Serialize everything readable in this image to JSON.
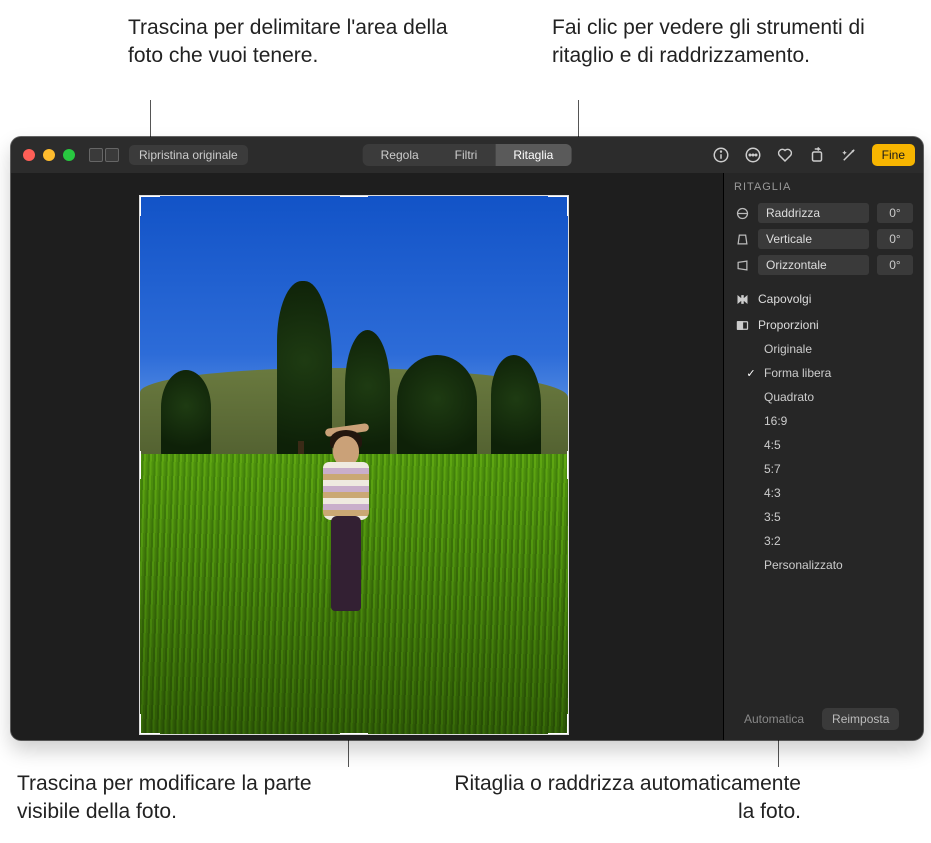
{
  "callouts": {
    "top_left": "Trascina per delimitare l'area della foto che vuoi tenere.",
    "top_right": "Fai clic per vedere gli strumenti di ritaglio e di raddrizzamento.",
    "bottom_left": "Trascina per modificare la parte visibile della foto.",
    "bottom_right": "Ritaglia o raddrizza automaticamente la foto."
  },
  "toolbar": {
    "restore_label": "Ripristina originale",
    "segments": {
      "adjust": "Regola",
      "filters": "Filtri",
      "crop": "Ritaglia"
    },
    "done_label": "Fine"
  },
  "sidebar": {
    "title": "RITAGLIA",
    "sliders": {
      "straighten": {
        "label": "Raddrizza",
        "value": "0°"
      },
      "vertical": {
        "label": "Verticale",
        "value": "0°"
      },
      "horizontal": {
        "label": "Orizzontale",
        "value": "0°"
      }
    },
    "flip_label": "Capovolgi",
    "aspect_title": "Proporzioni",
    "aspects": {
      "original": "Originale",
      "freeform": "Forma libera",
      "square": "Quadrato",
      "r16_9": "16:9",
      "r4_5": "4:5",
      "r5_7": "5:7",
      "r4_3": "4:3",
      "r3_5": "3:5",
      "r3_2": "3:2",
      "custom": "Personalizzato"
    },
    "footer": {
      "auto_label": "Automatica",
      "reset_label": "Reimposta"
    }
  }
}
